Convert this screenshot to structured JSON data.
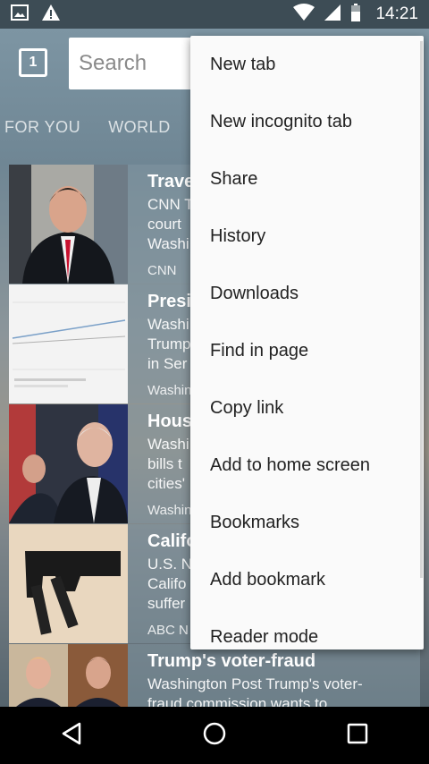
{
  "status_bar": {
    "time": "14:21",
    "icons": [
      "image-icon",
      "warning-icon",
      "wifi-icon",
      "signal-icon",
      "battery-icon"
    ]
  },
  "toolbar": {
    "tab_count": "1",
    "search_placeholder": "Search"
  },
  "categories": [
    "FOR YOU",
    "WORLD",
    "N"
  ],
  "news": [
    {
      "title": "Trave",
      "desc": [
        "CNN T",
        "court",
        "Washi"
      ],
      "source": "CNN"
    },
    {
      "title": "Presi",
      "desc": [
        "Washi",
        "Trump",
        "in Ser"
      ],
      "source": "Washin"
    },
    {
      "title": "Hous",
      "desc": [
        "Washi",
        "bills t",
        "cities'"
      ],
      "source": "Washin"
    },
    {
      "title": "Califo",
      "desc": [
        "U.S. N",
        "Califo",
        "suffer"
      ],
      "source": "ABC N"
    },
    {
      "title": "Trump's voter-fraud",
      "desc": [
        "Washington Post Trump's voter-",
        "fraud commission wants to"
      ],
      "source": ""
    }
  ],
  "menu": {
    "items": [
      "New tab",
      "New incognito tab",
      "Share",
      "History",
      "Downloads",
      "Find in page",
      "Copy link",
      "Add to home screen",
      "Bookmarks",
      "Add bookmark",
      "Reader mode"
    ]
  },
  "nav_bar": {
    "buttons": [
      "back-icon",
      "home-icon",
      "recents-icon"
    ]
  },
  "colors": {
    "status_bar": "#3d4c55",
    "menu_bg": "#fafafa",
    "nav_bar": "#000000"
  }
}
